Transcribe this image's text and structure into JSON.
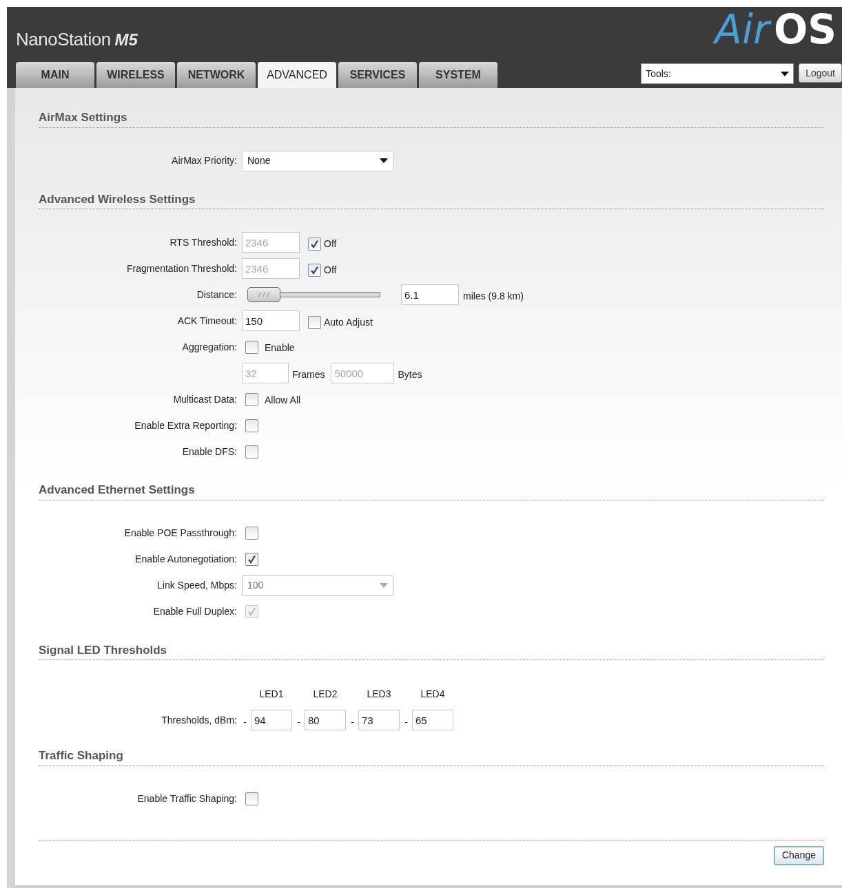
{
  "header": {
    "product": "NanoStation",
    "model": "M5",
    "logo": {
      "first": "Air",
      "second": "OS"
    }
  },
  "tabs": [
    {
      "label": "MAIN",
      "selected": false
    },
    {
      "label": "WIRELESS",
      "selected": false
    },
    {
      "label": "NETWORK",
      "selected": false
    },
    {
      "label": "ADVANCED",
      "selected": true
    },
    {
      "label": "SERVICES",
      "selected": false
    },
    {
      "label": "SYSTEM",
      "selected": false
    }
  ],
  "tools": {
    "value": "Tools:"
  },
  "logout": "Logout",
  "sections": [
    {
      "title": "AirMax Settings",
      "rows": [
        {
          "kind": "select",
          "label": "AirMax Priority:",
          "value": "None",
          "disabled": false
        }
      ]
    },
    {
      "title": "Advanced Wireless Settings",
      "rows": [
        {
          "kind": "input_check",
          "label": "RTS Threshold:",
          "value": "2346",
          "input_disabled": true,
          "checked": true,
          "check_label": "Off"
        },
        {
          "kind": "input_check",
          "label": "Fragmentation Threshold:",
          "value": "2346",
          "input_disabled": true,
          "checked": true,
          "check_label": "Off"
        },
        {
          "kind": "slider",
          "label": "Distance:",
          "level": 0.02,
          "value": "6.1",
          "unit": "miles (9.8 km)"
        },
        {
          "kind": "input_check",
          "label": "ACK Timeout:",
          "value": "150",
          "input_disabled": false,
          "checked": false,
          "check_label": "Auto Adjust"
        },
        {
          "kind": "check",
          "label": "Aggregation:",
          "checked": false,
          "disabled": false,
          "check_label": "Enable"
        },
        {
          "kind": "pair",
          "first": "32",
          "first_unit": "Frames",
          "second": "50000",
          "second_unit": "Bytes",
          "disabled": true
        },
        {
          "kind": "check",
          "label": "Multicast Data:",
          "checked": false,
          "disabled": false,
          "check_label": "Allow All"
        },
        {
          "kind": "check",
          "label": "Enable Extra Reporting:",
          "checked": false,
          "disabled": false
        },
        {
          "kind": "check",
          "label": "Enable DFS:",
          "checked": false,
          "disabled": false
        }
      ]
    },
    {
      "title": "Advanced Ethernet Settings",
      "rows": [
        {
          "kind": "check",
          "label": "Enable POE Passthrough:",
          "checked": false,
          "disabled": false
        },
        {
          "kind": "check",
          "label": "Enable Autonegotiation:",
          "checked": true,
          "disabled": false
        },
        {
          "kind": "select",
          "label": "Link Speed, Mbps:",
          "value": "100",
          "disabled": true
        },
        {
          "kind": "check",
          "label": "Enable Full Duplex:",
          "checked": true,
          "disabled": true
        }
      ]
    },
    {
      "title": "Signal LED Thresholds",
      "rows": [
        {
          "kind": "thresholds",
          "label": "Thresholds, dBm:",
          "leds": [
            {
              "name": "LED1",
              "sign": "-",
              "value": "94"
            },
            {
              "name": "LED2",
              "sign": "-",
              "value": "80"
            },
            {
              "name": "LED3",
              "sign": "-",
              "value": "73"
            },
            {
              "name": "LED4",
              "sign": "-",
              "value": "65"
            }
          ]
        }
      ]
    },
    {
      "title": "Traffic Shaping",
      "rows": [
        {
          "kind": "check",
          "label": "Enable Traffic Shaping:",
          "checked": false,
          "disabled": false
        }
      ]
    }
  ],
  "change_button": "Change"
}
